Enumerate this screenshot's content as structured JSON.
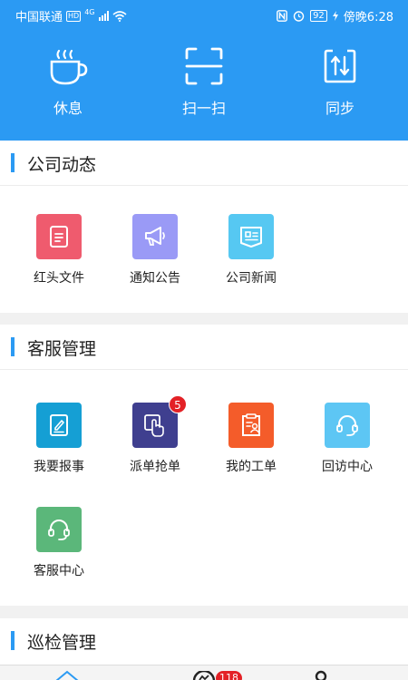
{
  "status_bar": {
    "carrier": "中国联通",
    "hd": "HD",
    "network": "4G",
    "battery": "92",
    "time": "傍晚6:28"
  },
  "quick_actions": [
    {
      "label": "休息",
      "icon": "coffee-cup-icon"
    },
    {
      "label": "扫一扫",
      "icon": "scan-frame-icon"
    },
    {
      "label": "同步",
      "icon": "sync-arrows-icon"
    }
  ],
  "sections": [
    {
      "title": "公司动态",
      "items": [
        {
          "label": "红头文件",
          "icon": "document-icon",
          "color": "#ef5b6e"
        },
        {
          "label": "通知公告",
          "icon": "megaphone-icon",
          "color": "#9a9af6"
        },
        {
          "label": "公司新闻",
          "icon": "news-icon",
          "color": "#56c8f2"
        }
      ]
    },
    {
      "title": "客服管理",
      "items": [
        {
          "label": "我要报事",
          "icon": "report-edit-icon",
          "color": "#159fd4"
        },
        {
          "label": "派单抢单",
          "icon": "hand-tap-icon",
          "color": "#3f3f8f",
          "badge": "5"
        },
        {
          "label": "我的工单",
          "icon": "clipboard-user-icon",
          "color": "#f45c2a"
        },
        {
          "label": "回访中心",
          "icon": "headset-icon",
          "color": "#5dc6f4"
        },
        {
          "label": "客服中心",
          "icon": "headset-icon",
          "color": "#5bb77a"
        }
      ]
    },
    {
      "title": "巡检管理",
      "items": []
    }
  ],
  "tab_bar": {
    "badge": "118"
  }
}
